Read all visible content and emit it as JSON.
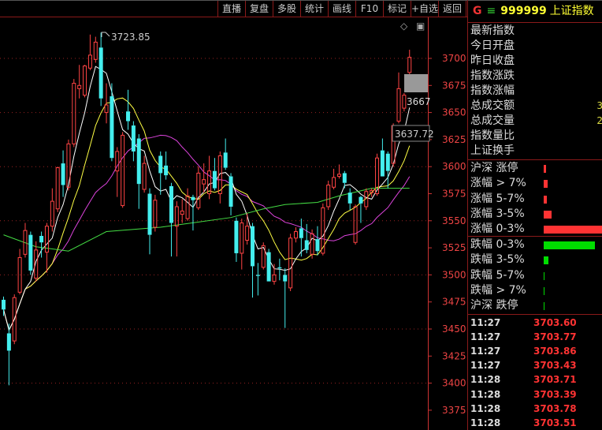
{
  "toolbar": {
    "buttons": [
      "直播",
      "复盘",
      "多股",
      "统计",
      "画线",
      "F10",
      "标记",
      "+自选",
      "返回"
    ]
  },
  "header": {
    "g_label": "G",
    "menu_glyph": "≡",
    "code": "999999",
    "name": "上证指数"
  },
  "chart_icons": {
    "diamond": "◇",
    "window": "▣"
  },
  "info": [
    {
      "label": "最新指数",
      "value": ""
    },
    {
      "label": "今日开盘",
      "value": ""
    },
    {
      "label": "昨日收盘",
      "value": ""
    },
    {
      "label": "指数涨跌",
      "value": ""
    },
    {
      "label": "指数涨幅",
      "value": ""
    },
    {
      "label": "总成交额",
      "value": "3"
    },
    {
      "label": "总成交量",
      "value": "2"
    },
    {
      "label": "指数量比",
      "value": ""
    },
    {
      "label": "上证换手",
      "value": ""
    }
  ],
  "distribution": {
    "up": [
      {
        "label": "沪深 涨停",
        "fill": 0.04
      },
      {
        "label": "涨幅 > 7%",
        "fill": 0.06
      },
      {
        "label": "涨幅 5-7%",
        "fill": 0.05
      },
      {
        "label": "涨幅 3-5%",
        "fill": 0.13
      },
      {
        "label": "涨幅 0-3%",
        "fill": 1.0
      }
    ],
    "down": [
      {
        "label": "跌幅 0-3%",
        "fill": 0.86
      },
      {
        "label": "跌幅 3-5%",
        "fill": 0.08
      },
      {
        "label": "跌幅 5-7%",
        "fill": 0.01
      },
      {
        "label": "跌幅 > 7%",
        "fill": 0.01
      },
      {
        "label": "沪深 跌停",
        "fill": 0.01
      }
    ],
    "up_color": "#ff3333",
    "down_color": "#00dd00"
  },
  "ticks": [
    {
      "time": "11:27",
      "price": "3703.60"
    },
    {
      "time": "11:27",
      "price": "3703.77"
    },
    {
      "time": "11:27",
      "price": "3703.86"
    },
    {
      "time": "11:27",
      "price": "3703.43"
    },
    {
      "time": "11:28",
      "price": "3703.71"
    },
    {
      "time": "11:28",
      "price": "3703.39"
    },
    {
      "time": "11:28",
      "price": "3703.78"
    },
    {
      "time": "11:28",
      "price": "3703.51"
    }
  ],
  "chart_data": {
    "type": "candlestick",
    "ylim": [
      3362,
      3736
    ],
    "yticks": [
      3700,
      3675,
      3650,
      3625,
      3600,
      3575,
      3550,
      3525,
      3500,
      3475,
      3450,
      3425,
      3400,
      3375
    ],
    "grid_levels": [
      3700,
      3650,
      3600,
      3550,
      3500,
      3450,
      3400
    ],
    "annotations": {
      "high_label": "3723.85",
      "high_value": 3723.85,
      "cursor_label": "3667",
      "box_label": "3637.72"
    },
    "colors": {
      "up": "#ff4444",
      "down": "#44eeee",
      "ma5": "#ffffff",
      "ma10": "#ffff44",
      "ma20": "#dd44dd",
      "ma60": "#44dd44",
      "axis": "#cc3333"
    },
    "ohlc": [
      [
        3477,
        3480,
        3462,
        3468
      ],
      [
        3446,
        3455,
        3398,
        3430
      ],
      [
        3439,
        3482,
        3436,
        3479
      ],
      [
        3484,
        3524,
        3482,
        3516
      ],
      [
        3519,
        3548,
        3516,
        3541
      ],
      [
        3537,
        3540,
        3500,
        3504
      ],
      [
        3497,
        3531,
        3494,
        3523
      ],
      [
        3536,
        3540,
        3516,
        3530
      ],
      [
        3521,
        3548,
        3502,
        3545
      ],
      [
        3545,
        3580,
        3540,
        3568
      ],
      [
        3561,
        3600,
        3558,
        3599
      ],
      [
        3603,
        3615,
        3572,
        3583
      ],
      [
        3581,
        3625,
        3578,
        3621
      ],
      [
        3621,
        3681,
        3618,
        3677
      ],
      [
        3672,
        3694,
        3663,
        3675
      ],
      [
        3666,
        3694,
        3664,
        3693
      ],
      [
        3691,
        3722,
        3689,
        3703
      ],
      [
        3699,
        3720,
        3696,
        3715
      ],
      [
        3710,
        3723.85,
        3656,
        3663
      ],
      [
        3650,
        3677,
        3640,
        3657
      ],
      [
        3665,
        3677,
        3605,
        3608
      ],
      [
        3596,
        3618,
        3572,
        3614
      ],
      [
        3564,
        3632,
        3562,
        3629
      ],
      [
        3651,
        3671,
        3634,
        3642
      ],
      [
        3638,
        3642,
        3605,
        3614
      ],
      [
        3626,
        3630,
        3561,
        3584
      ],
      [
        3579,
        3610,
        3576,
        3603
      ],
      [
        3575,
        3580,
        3519,
        3537
      ],
      [
        3544,
        3574,
        3540,
        3569
      ],
      [
        3610,
        3614,
        3574,
        3594
      ],
      [
        3601,
        3614,
        3588,
        3592
      ],
      [
        3582,
        3585,
        3517,
        3548
      ],
      [
        3545,
        3568,
        3517,
        3563
      ],
      [
        3556,
        3570,
        3548,
        3559
      ],
      [
        3552,
        3580,
        3550,
        3573
      ],
      [
        3572,
        3574,
        3541,
        3569
      ],
      [
        3562,
        3600,
        3560,
        3594
      ],
      [
        3584,
        3603,
        3576,
        3588
      ],
      [
        3575,
        3610,
        3570,
        3596
      ],
      [
        3596,
        3608,
        3578,
        3580
      ],
      [
        3575,
        3614,
        3566,
        3610
      ],
      [
        3613,
        3626,
        3597,
        3599
      ],
      [
        3591,
        3594,
        3555,
        3563
      ],
      [
        3550,
        3553,
        3512,
        3520
      ],
      [
        3520,
        3552,
        3505,
        3548
      ],
      [
        3532,
        3557,
        3528,
        3545
      ],
      [
        3545,
        3548,
        3479,
        3508
      ],
      [
        3500,
        3511,
        3481,
        3499
      ],
      [
        3507,
        3530,
        3505,
        3527
      ],
      [
        3521,
        3524,
        3494,
        3494
      ],
      [
        3494,
        3510,
        3491,
        3500
      ],
      [
        3507,
        3515,
        3495,
        3506
      ],
      [
        3500,
        3506,
        3451,
        3494
      ],
      [
        3488,
        3538,
        3485,
        3534
      ],
      [
        3534,
        3544,
        3530,
        3540
      ],
      [
        3543,
        3552,
        3517,
        3534
      ],
      [
        3532,
        3547,
        3520,
        3523
      ],
      [
        3519,
        3542,
        3515,
        3538
      ],
      [
        3533,
        3545,
        3518,
        3522
      ],
      [
        3520,
        3566,
        3518,
        3562
      ],
      [
        3563,
        3587,
        3560,
        3583
      ],
      [
        3581,
        3598,
        3579,
        3590
      ],
      [
        3591,
        3602,
        3589,
        3593
      ],
      [
        3594,
        3596,
        3580,
        3585
      ],
      [
        3576,
        3580,
        3560,
        3566
      ],
      [
        3530,
        3565,
        3528,
        3563
      ],
      [
        3572,
        3573,
        3548,
        3566
      ],
      [
        3563,
        3580,
        3560,
        3577
      ],
      [
        3576,
        3580,
        3572,
        3578
      ],
      [
        3575,
        3612,
        3573,
        3608
      ],
      [
        3615,
        3626,
        3592,
        3591
      ],
      [
        3612,
        3614,
        3580,
        3596
      ],
      [
        3603,
        3640,
        3600,
        3638
      ],
      [
        3642,
        3687,
        3640,
        3672
      ],
      [
        3654,
        3668,
        3651,
        3666
      ],
      [
        3687,
        3708,
        3685,
        3701
      ]
    ],
    "ma60": [
      [
        0,
        3537
      ],
      [
        6,
        3526
      ],
      [
        12,
        3522
      ],
      [
        19,
        3540
      ],
      [
        29,
        3544
      ],
      [
        42,
        3553
      ],
      [
        48,
        3561
      ],
      [
        52,
        3565
      ],
      [
        58,
        3567
      ],
      [
        62,
        3573
      ],
      [
        68,
        3580
      ],
      [
        75,
        3580
      ]
    ]
  }
}
